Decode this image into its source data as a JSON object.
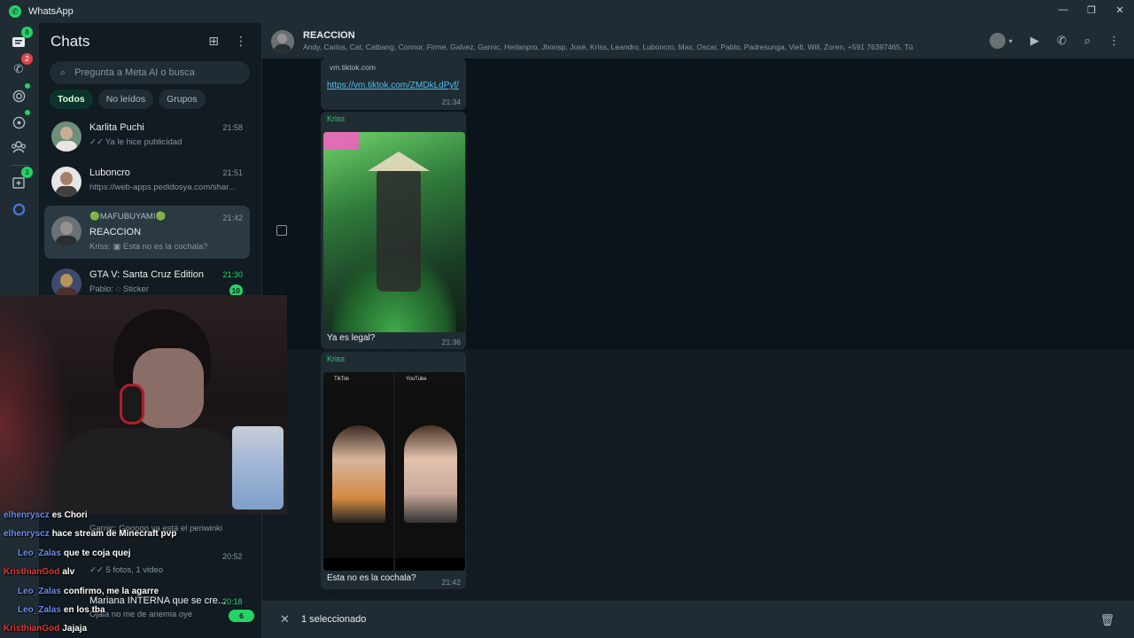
{
  "window": {
    "title": "WhatsApp",
    "controls": [
      "—",
      "❐",
      "✕"
    ]
  },
  "rail": {
    "chats_badge": "8",
    "calls_badge": "2",
    "communities_badge": "3"
  },
  "chatlist": {
    "title": "Chats",
    "search_placeholder": "Pregunta a Meta AI o busca",
    "filters": [
      "Todos",
      "No leídos",
      "Grupos"
    ],
    "items": [
      {
        "name": "Karlita Puchi",
        "time": "21:58",
        "preview": "Ya le hice publicidad",
        "ticks": "✓✓"
      },
      {
        "name": "Luboncro",
        "time": "21:51",
        "preview": "https://web-apps.pedidosya.com/shar..."
      },
      {
        "name_prefix": "MAFUBUYAMI",
        "name": "REACCION",
        "time": "21:42",
        "preview": "Kriss: ▣ Esta no es la cochala?"
      },
      {
        "name": "GTA V: Santa Cruz Edition",
        "time": "21:30",
        "preview": "Pablo: ◌ Sticker",
        "unread": "10"
      }
    ],
    "hidden_rows": [
      {
        "preview": "Garnic: Gooooo ya está el periwinki"
      },
      {
        "time": "20:52",
        "preview": "5 fotos, 1 video"
      },
      {
        "name": "Mariana INTERNA que se cre...",
        "time": "20:18",
        "preview": "Ojala no me de anemia oye",
        "unread": "6"
      }
    ]
  },
  "conversation": {
    "group_name": "REACCION",
    "members": "Andy, Carlos, Cat, Catbang, Connor, Firme, Galvez, Garnic, Herlanpro, Jhonsp, José, Kriss, Leandro, Luboncro, Max, Oscar, Pablo, Padresunga, Vielt, Will, Zoren, +591 76397465, Tú",
    "messages": [
      {
        "domain": "vm.tiktok.com",
        "link": "https://vm.tiktok.com/ZMDkLdPyf/",
        "time": "21:34"
      },
      {
        "sender": "Kriss",
        "caption": "Ya es legal?",
        "time": "21:36"
      },
      {
        "sender": "Kriss",
        "caption": "Esta no es la cochala?",
        "time": "21:42",
        "img_left_label": "TikTok",
        "img_right_label": "YouTube"
      }
    ],
    "selection_label": "1 seleccionado"
  },
  "stream_chat": [
    {
      "user": "elhenryscz",
      "msg": "es Chori",
      "color": "blue"
    },
    {
      "user": "elhenryscz",
      "msg": "hace stream de Minecraft pvp",
      "color": "blue"
    },
    {
      "user": "Leo_Zalas",
      "msg": "que te coja quej",
      "color": "blue"
    },
    {
      "user": "KristhianGod",
      "msg": "alv",
      "color": "red"
    },
    {
      "user": "Leo_Zalas",
      "msg": "confirmo, me la agarre",
      "color": "blue"
    },
    {
      "user": "Leo_Zalas",
      "msg": "en los tba",
      "color": "blue"
    },
    {
      "user": "KristhianGod",
      "msg": "Jajaja",
      "color": "red"
    }
  ]
}
